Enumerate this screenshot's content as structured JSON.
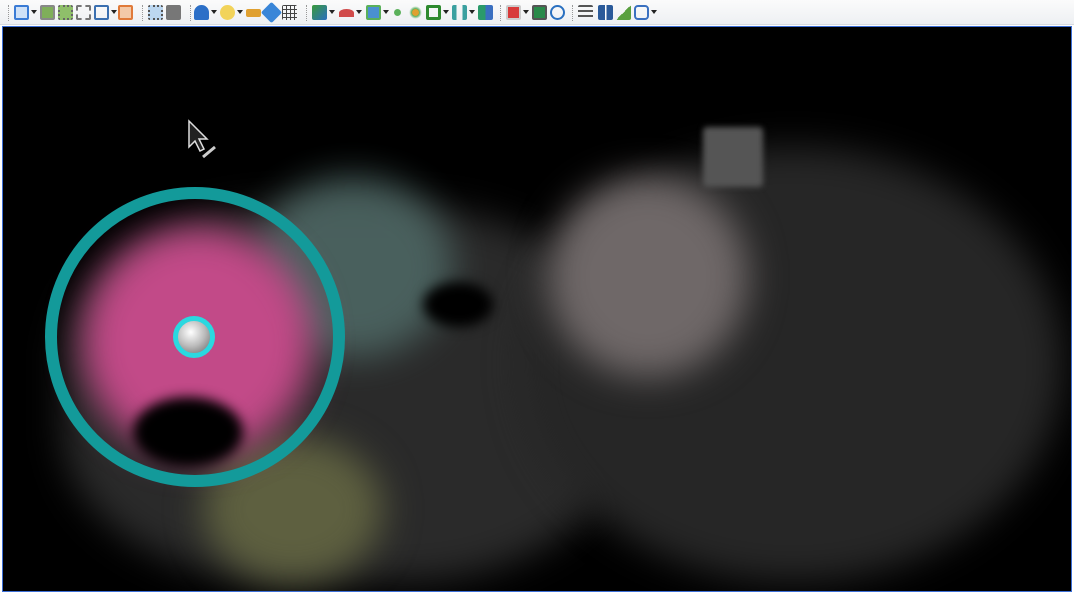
{
  "toolbar": {
    "icons": [
      "view-cube-icon",
      "zoom-extents-icon",
      "zoom-selection-icon",
      "zoom-fit-icon",
      "viewport-layout-icon",
      "projection-icon",
      "select-region-icon",
      "restore-view-icon",
      "point-rendering-icon",
      "lighting-icon",
      "flashlight-icon",
      "measure-tag-icon",
      "grid-icon",
      "point-classification-icon",
      "section-box-icon",
      "clip-icon",
      "registration-icon",
      "target-icon",
      "bounding-box-icon",
      "sync-icon",
      "compare-icon",
      "pdf-export-icon",
      "snapshot-icon",
      "play-animation-icon",
      "list-view-icon",
      "split-view-icon",
      "terrain-icon",
      "link-icon"
    ]
  },
  "viewport": {
    "accent": "#139a9a",
    "highlight": "#2ad8e0"
  }
}
